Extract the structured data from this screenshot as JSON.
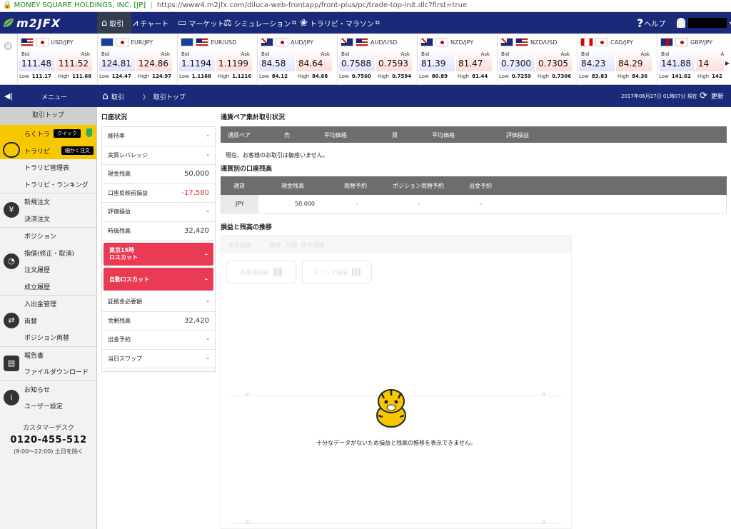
{
  "browser": {
    "site": "MONEY SQUARE HOLDINGS, INC. [JP]",
    "url": "https://www4.m2jfx.com/diluca-web-frontapp/front-plus/pc/trade-top-init.dlc?first=true"
  },
  "nav": {
    "logo": "m2JFX",
    "items": [
      {
        "label": "取引",
        "icon": "home-icon"
      },
      {
        "label": "チャート",
        "icon": "chart-icon"
      },
      {
        "label": "マーケット",
        "icon": "monitor-icon"
      },
      {
        "label": "シミュレーション",
        "icon": "simulation-icon"
      },
      {
        "label": "トラリピ・マラソン",
        "icon": "marathon-icon"
      }
    ],
    "help": "ヘルプ"
  },
  "ticker": {
    "bid_label": "Bid",
    "ask_label": "Ask",
    "low_label": "Low",
    "high_label": "High",
    "pairs": [
      {
        "name": "USD/JPY",
        "f1": "us",
        "f2": "jp",
        "bid": "111.48",
        "ask": "111.52",
        "low": "111.17",
        "high": "111.68"
      },
      {
        "name": "EUR/JPY",
        "f1": "eu",
        "f2": "jp",
        "bid": "124.81",
        "ask": "124.86",
        "low": "124.47",
        "high": "124.97"
      },
      {
        "name": "EUR/USD",
        "f1": "eu",
        "f2": "us",
        "bid": "1.1194",
        "ask": "1.1199",
        "low": "1.1168",
        "high": "1.1216"
      },
      {
        "name": "AUD/JPY",
        "f1": "au",
        "f2": "jp",
        "bid": "84.58",
        "ask": "84.64",
        "low": "84.12",
        "high": "84.68"
      },
      {
        "name": "AUD/USD",
        "f1": "au",
        "f2": "us",
        "bid": "0.7588",
        "ask": "0.7593",
        "low": "0.7560",
        "high": "0.7594"
      },
      {
        "name": "NZD/JPY",
        "f1": "nz",
        "f2": "jp",
        "bid": "81.39",
        "ask": "81.47",
        "low": "80.89",
        "high": "81.44"
      },
      {
        "name": "NZD/USD",
        "f1": "nz",
        "f2": "us",
        "bid": "0.7300",
        "ask": "0.7305",
        "low": "0.7259",
        "high": "0.7306"
      },
      {
        "name": "CAD/JPY",
        "f1": "ca",
        "f2": "jp",
        "bid": "84.23",
        "ask": "84.29",
        "low": "83.83",
        "high": "84.36"
      },
      {
        "name": "GBP/JPY",
        "f1": "gb",
        "f2": "jp",
        "bid": "141.88",
        "ask": "14",
        "low": "141.62",
        "high": "142"
      }
    ]
  },
  "crumb": {
    "menu": "メニュー",
    "home": "取引",
    "current": "取引トップ",
    "datetime": "2017年06月27日 01時07分 現在",
    "refresh": "更新"
  },
  "sidebar": {
    "top": "取引トップ",
    "rakutora": "らくトラ",
    "quick_badge": "クイック",
    "torapi": "トラリピ",
    "detail_badge": "細かく注文",
    "g1": [
      "トラリピ管理表",
      "トラリピ・ランキング"
    ],
    "g2": [
      "新規注文",
      "決済注文"
    ],
    "g3": [
      "ポジション",
      "指値(修正・取消)",
      "注文履歴",
      "成立履歴"
    ],
    "g4": [
      "入出金管理",
      "両替",
      "ポジション両替"
    ],
    "g5": [
      "報告書",
      "ファイルダウンロード"
    ],
    "g6": [
      "お知らせ",
      "ユーザー設定"
    ],
    "desk_title": "カスタマーデスク",
    "desk_tel": "0120-455-512",
    "desk_hours": "(9:00～22:00) 土日を除く"
  },
  "account": {
    "title": "口座状況",
    "rows": [
      {
        "label": "維持率",
        "value": "-"
      },
      {
        "label": "実質レバレッジ",
        "value": "-"
      },
      {
        "label": "現金残高",
        "value": "50,000"
      },
      {
        "label": "口座反映前損益",
        "value": "-17,580"
      },
      {
        "label": "評価損益",
        "value": "-"
      },
      {
        "label": "時価残高",
        "value": "32,420"
      }
    ],
    "losscut1_a": "東京15時",
    "losscut1_b": "ロスカット",
    "losscut1_value": "-",
    "losscut2": "自動ロスカット",
    "losscut2_value": "-",
    "rows2": [
      {
        "label": "証拠金必要額",
        "value": "-"
      },
      {
        "label": "余剰残高",
        "value": "32,420"
      },
      {
        "label": "出金予約",
        "value": "-"
      },
      {
        "label": "当日スワップ",
        "value": "-"
      }
    ]
  },
  "summary": {
    "title": "通貨ペア集計取引状況",
    "headers": [
      "通貨ペア",
      "売",
      "平均価格",
      "買",
      "平均価格",
      "評価損益"
    ],
    "empty": "現在、お客様のお取引は御座いません。"
  },
  "balance": {
    "title": "通貨別の口座残高",
    "headers": [
      "通貨",
      "現金残高",
      "両替予約",
      "ポジション両替予約",
      "出金予約"
    ],
    "row": [
      "JPY",
      "50,000",
      "-",
      "-",
      "-"
    ]
  },
  "trend": {
    "title": "損益と残高の推移",
    "tabs": [
      "表示期間",
      "週間",
      "月間",
      "四半期間"
    ],
    "btn1": "両替差損益",
    "btn2": "スワップ損益",
    "zero": "0",
    "nodata": "十分なデータがないため損益と残高の推移を表示できません。"
  }
}
